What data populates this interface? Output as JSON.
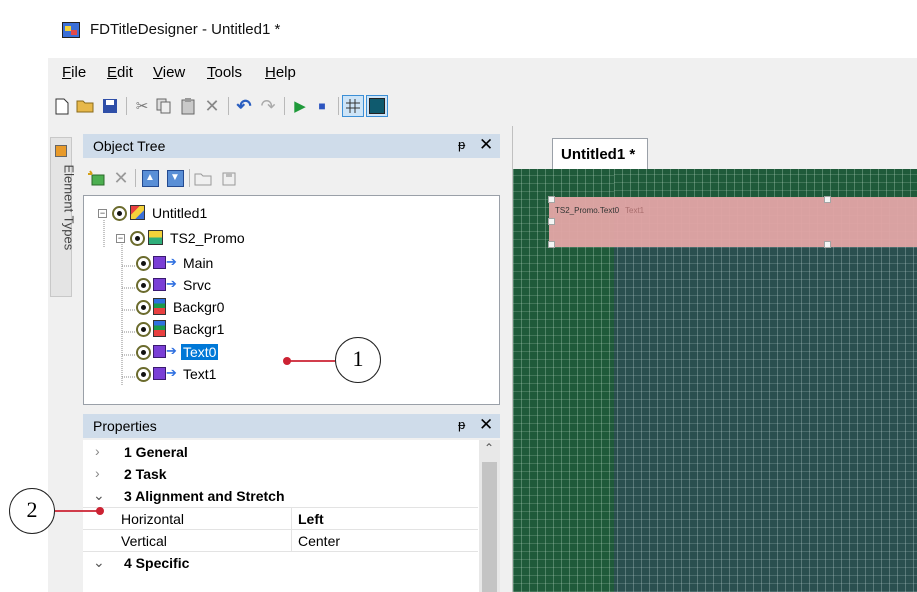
{
  "window": {
    "title": "FDTitleDesigner - Untitled1 *",
    "accent": "#cfdcea"
  },
  "menu": {
    "items": [
      {
        "key": "F",
        "rest": "ile"
      },
      {
        "key": "E",
        "rest": "dit"
      },
      {
        "key": "V",
        "rest": "iew"
      },
      {
        "key": "T",
        "rest": "ools"
      },
      {
        "key": "H",
        "rest": "elp"
      }
    ]
  },
  "toolbar": {
    "icons": [
      "new-icon",
      "open-icon",
      "save-icon",
      "cut-icon",
      "copy-icon",
      "paste-icon",
      "delete-icon",
      "undo-icon",
      "redo-icon",
      "play-icon",
      "stop-icon",
      "grid-icon",
      "background-color-icon"
    ]
  },
  "side_tab": {
    "label": "Element Types"
  },
  "object_tree": {
    "title": "Object Tree",
    "pin": "ᵽ",
    "close": "✕",
    "nodes": [
      {
        "label": "Untitled1"
      },
      {
        "label": "TS2_Promo"
      },
      {
        "label": "Main"
      },
      {
        "label": "Srvc"
      },
      {
        "label": "Backgr0"
      },
      {
        "label": "Backgr1"
      },
      {
        "label": "Text0"
      },
      {
        "label": "Text1"
      }
    ],
    "selected": "Text0"
  },
  "properties": {
    "title": "Properties",
    "pin": "ᵽ",
    "close": "✕",
    "rows": [
      {
        "type": "category",
        "expanded": false,
        "label": "1 General"
      },
      {
        "type": "category",
        "expanded": false,
        "label": "2 Task"
      },
      {
        "type": "category",
        "expanded": true,
        "label": "3 Alignment and Stretch"
      },
      {
        "type": "property",
        "name": "Horizontal",
        "value": "Left"
      },
      {
        "type": "property",
        "name": "Vertical",
        "value": "Center"
      },
      {
        "type": "category",
        "expanded": true,
        "label": "4 Specific"
      }
    ]
  },
  "editor": {
    "tab_label": "Untitled1 *",
    "object_label": "TS2_Promo.Text0",
    "object_label_ghost": "Text1"
  },
  "callouts": {
    "one": "1",
    "two": "2"
  },
  "colors": {
    "selection": "#0078d7",
    "canvas_teal": "#2a4f4f",
    "canvas_green": "#1f5a3a",
    "text_object": "#e8a8a8",
    "callout_line": "#cc2233"
  }
}
